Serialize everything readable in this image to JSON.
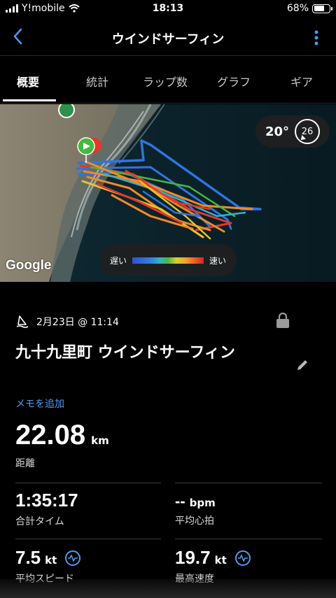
{
  "status_bar": {
    "carrier": "Y!mobile",
    "time": "18:13",
    "battery_percent": "68%",
    "battery_level": 0.68
  },
  "header": {
    "title": "ウインドサーフィン",
    "back_icon": "chevron-left-icon",
    "more_icon": "vertical-ellipsis-icon"
  },
  "tabs": [
    {
      "label": "概要",
      "active": true
    },
    {
      "label": "統計",
      "active": false
    },
    {
      "label": "ラップ数",
      "active": false
    },
    {
      "label": "グラフ",
      "active": false
    },
    {
      "label": "ギア",
      "active": false
    }
  ],
  "map": {
    "weather": {
      "temperature": "20°",
      "wind_speed": "26"
    },
    "legend": {
      "slow_label": "遅い",
      "fast_label": "速い"
    },
    "google_logo": "Google",
    "colors": {
      "blue": "#2f74e0",
      "red": "#e03a2a",
      "orange": "#f08a2a",
      "yellow": "#e8c42a",
      "green": "#45b83f"
    }
  },
  "activity": {
    "date": "2月23日 @ 11:14",
    "title": "九十九里町 ウインドサーフィン",
    "add_memo": "メモを追加",
    "distance": {
      "value": "22.08",
      "unit": "km",
      "label": "距離"
    }
  },
  "stats": [
    {
      "value": "1:35:17",
      "unit": "",
      "label": "合計タイム"
    },
    {
      "value": "--",
      "unit": "bpm",
      "label": "平均心拍"
    },
    {
      "value": "7.5",
      "unit": "kt",
      "label": "平均スピード"
    },
    {
      "value": "19.7",
      "unit": "kt",
      "label": "最高速度"
    }
  ],
  "accent_color": "#4d9bf0"
}
